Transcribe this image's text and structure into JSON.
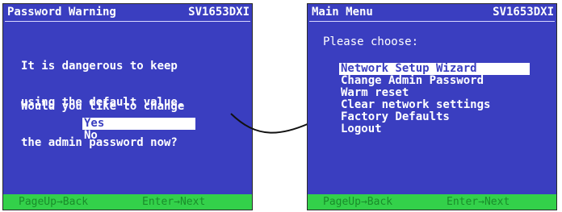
{
  "left_screen": {
    "title": "Password Warning",
    "model": "SV1653DXI",
    "message_lines": [
      "It is dangerous to keep",
      "using the default value."
    ],
    "question_lines": [
      "Would you like to change",
      "the admin password now?"
    ],
    "options": [
      {
        "label": "Yes",
        "selected": true
      },
      {
        "label": "No",
        "selected": false
      }
    ],
    "status": {
      "back": "PageUp→Back",
      "next": "Enter→Next"
    }
  },
  "right_screen": {
    "title": "Main Menu",
    "model": "SV1653DXI",
    "prompt": "Please choose:",
    "options": [
      {
        "label": "Network Setup Wizard",
        "selected": true
      },
      {
        "label": "Change Admin Password",
        "selected": false
      },
      {
        "label": "Warm reset",
        "selected": false
      },
      {
        "label": "Clear network settings",
        "selected": false
      },
      {
        "label": "Factory Defaults",
        "selected": false
      },
      {
        "label": "Logout",
        "selected": false
      }
    ],
    "status": {
      "back": "PageUp→Back",
      "next": "Enter→Next"
    }
  },
  "colors": {
    "screen_bg": "#3a3ec0",
    "text": "#ffffff",
    "status_bg": "#33d14a",
    "status_text": "#1a8c2a"
  },
  "icons": {
    "connector": "curved-arrow-icon"
  }
}
